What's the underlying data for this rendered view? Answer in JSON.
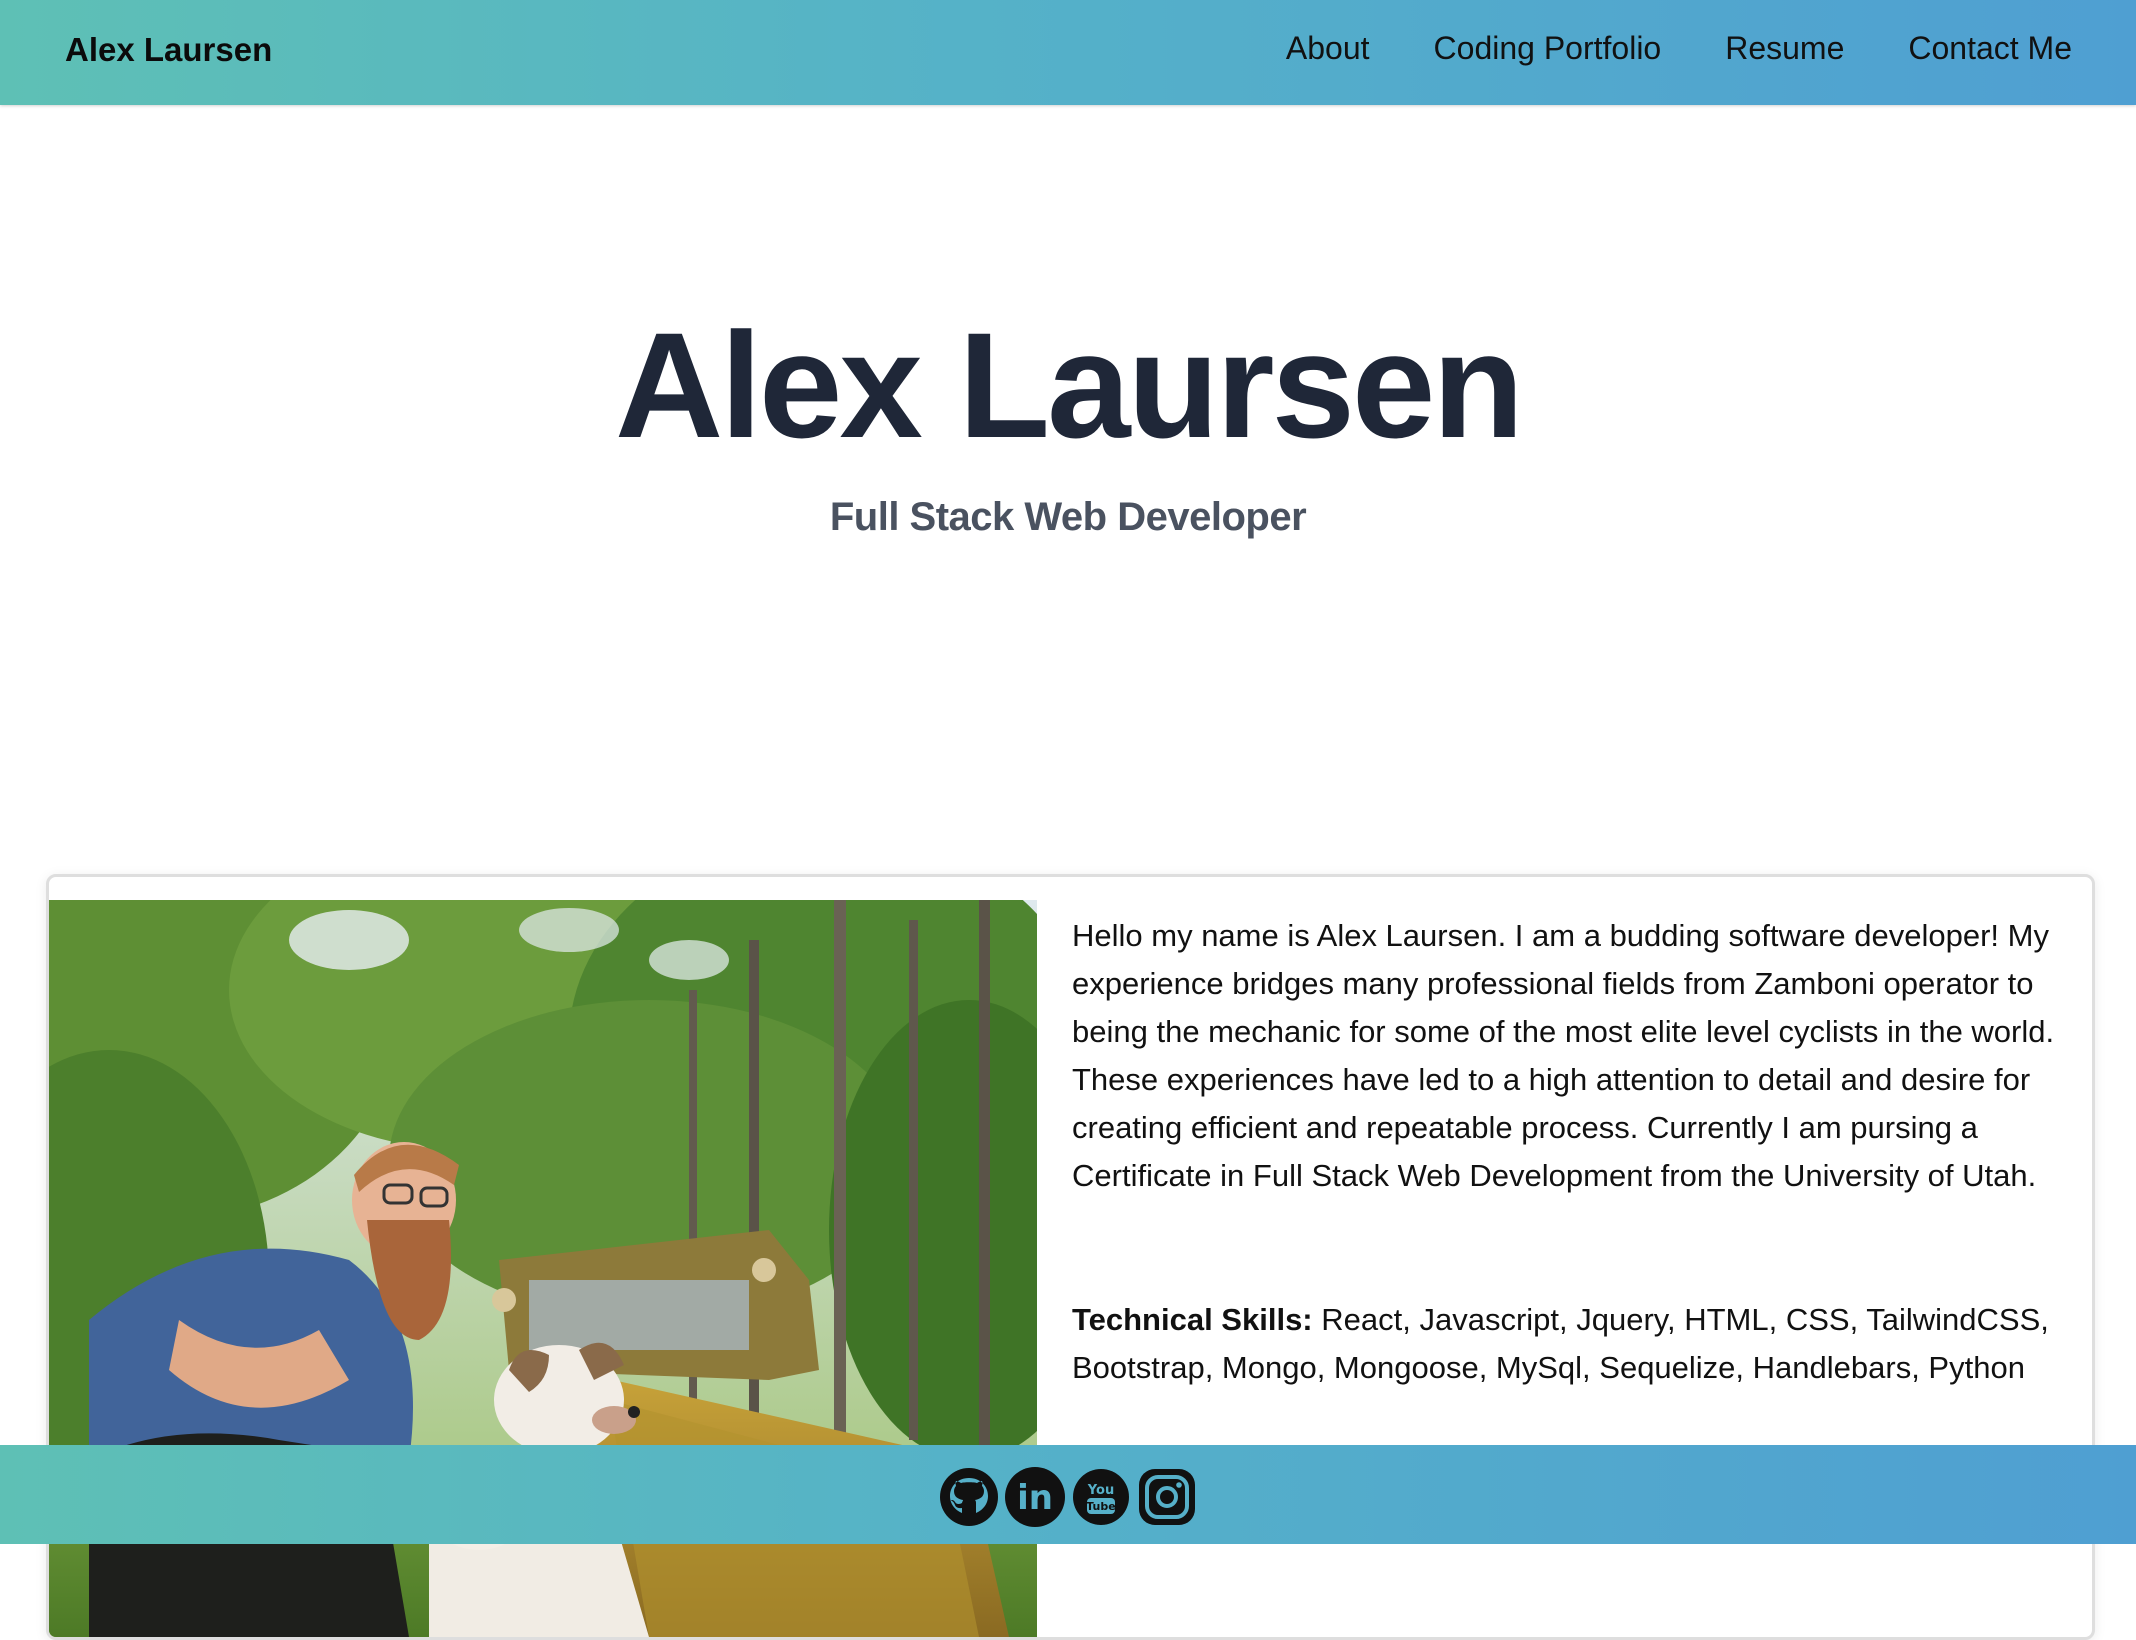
{
  "nav": {
    "brand": "Alex Laursen",
    "links": [
      "About",
      "Coding Portfolio",
      "Resume",
      "Contact Me"
    ]
  },
  "hero": {
    "title": "Alex Laursen",
    "subtitle": "Full Stack Web Developer"
  },
  "about": {
    "bio": "Hello my name is Alex Laursen. I am a budding software developer! My experience bridges many professional fields from Zamboni operator to being the mechanic for some of the most elite level cyclists in the world. These experiences have led to a high attention to detail and desire for creating efficient and repeatable process. Currently I am pursing a Certificate in Full Stack Web Development from the University of Utah.",
    "skills_label": "Technical Skills:",
    "skills_list": "React, Javascript, Jquery, HTML, CSS, TailwindCSS, Bootstrap, Mongo, Mongoose, MySql, Sequelize, Handlebars, Python"
  },
  "footer": {
    "icons": [
      "github-icon",
      "linkedin-icon",
      "youtube-icon",
      "instagram-icon"
    ],
    "youtube_text_top": "You",
    "youtube_text_bottom": "Tube",
    "linkedin_text": "in"
  },
  "colors": {
    "gradient_start": "#5ec0b5",
    "gradient_end": "#4f9fd2",
    "hero_title": "#1f2738",
    "hero_subtitle": "#4a5260"
  }
}
